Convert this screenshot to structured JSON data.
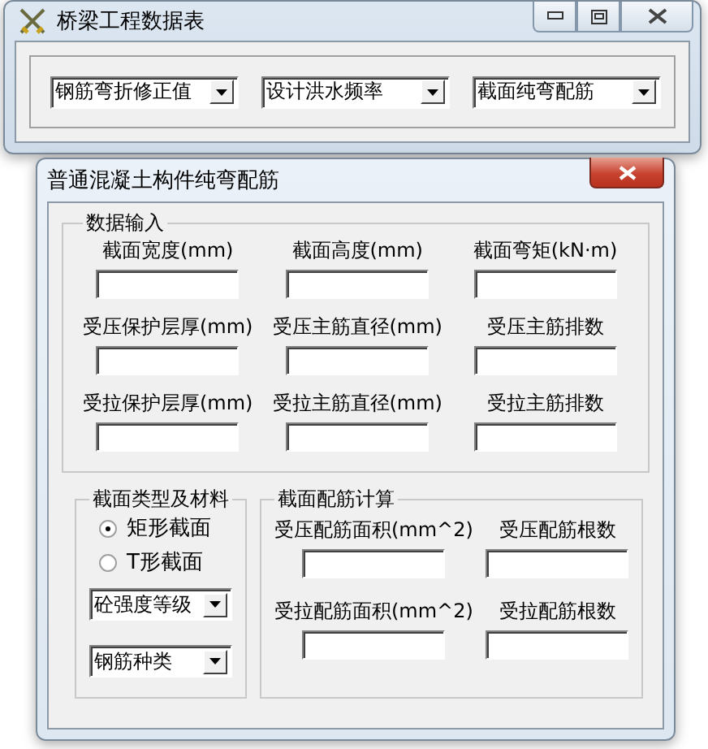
{
  "main_window": {
    "title": "桥梁工程数据表",
    "dropdowns": [
      {
        "value": "钢筋弯折修正值"
      },
      {
        "value": "设计洪水频率"
      },
      {
        "value": "截面纯弯配筋"
      }
    ]
  },
  "dialog": {
    "title": "普通混凝土构件纯弯配筋",
    "data_input": {
      "title": "数据输入",
      "fields": [
        {
          "label": "截面宽度(mm)"
        },
        {
          "label": "截面高度(mm)"
        },
        {
          "label": "截面弯矩(kN·m)"
        },
        {
          "label": "受压保护层厚(mm)"
        },
        {
          "label": "受压主筋直径(mm)"
        },
        {
          "label": "受压主筋排数"
        },
        {
          "label": "受拉保护层厚(mm)"
        },
        {
          "label": "受拉主筋直径(mm)"
        },
        {
          "label": "受拉主筋排数"
        }
      ]
    },
    "section_material": {
      "title": "截面类型及材料",
      "radios": [
        {
          "label": "矩形截面",
          "selected": true
        },
        {
          "label": "T形截面",
          "selected": false
        }
      ],
      "dropdowns": [
        {
          "value": "砼强度等级"
        },
        {
          "value": "钢筋种类"
        }
      ]
    },
    "reinforcement": {
      "title": "截面配筋计算",
      "fields": [
        {
          "label": "受压配筋面积(mm^2)"
        },
        {
          "label": "受压配筋根数"
        },
        {
          "label": "受拉配筋面积(mm^2)"
        },
        {
          "label": "受拉配筋根数"
        }
      ]
    }
  }
}
